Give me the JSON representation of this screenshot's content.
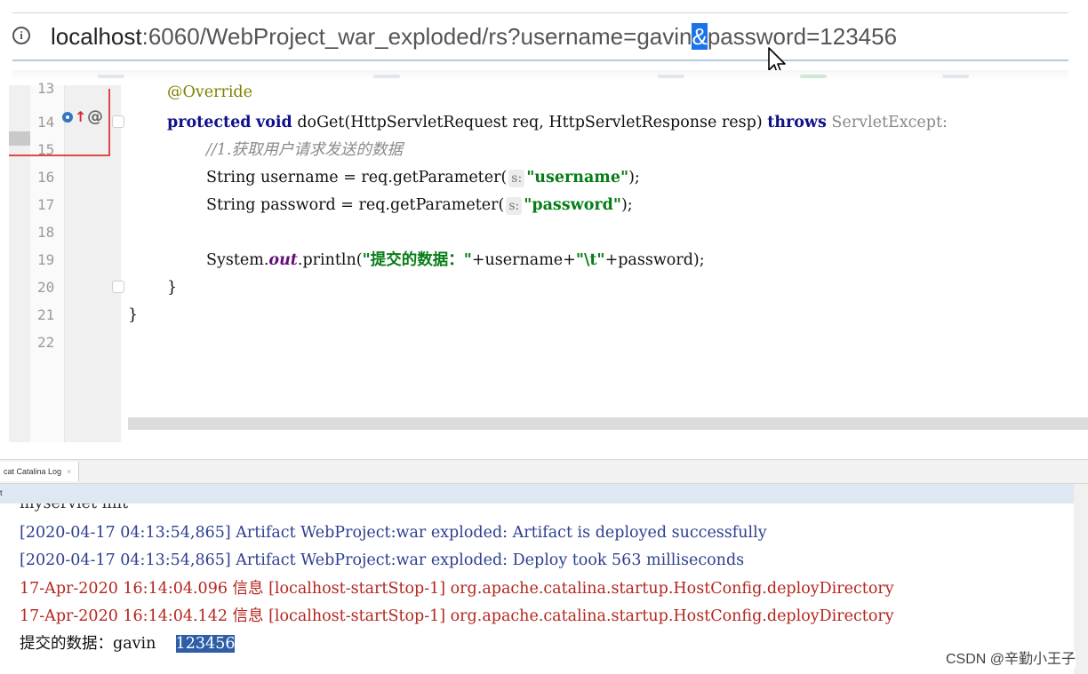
{
  "address_bar": {
    "url_host": "localhost",
    "url_rest": ":6060/WebProject_war_exploded/rs?username=gavin",
    "url_amp": "&",
    "url_tail": "password=123456"
  },
  "editor": {
    "line_numbers": [
      "13",
      "14",
      "15",
      "16",
      "17",
      "18",
      "19",
      "20",
      "21",
      "22"
    ],
    "lines": {
      "l13": {
        "annotation": "@Override"
      },
      "l14": {
        "kw1": "protected",
        "kw2": "void",
        "sig": " doGet(HttpServletRequest req, HttpServletResponse resp) ",
        "kw3": "throws",
        "exc": " ServletExcept:"
      },
      "l15": {
        "comment": "//1.获取用户请求发送的数据"
      },
      "l16": {
        "pre": "String username = req.getParameter(",
        "hint": "s:",
        "str": "\"username\"",
        "post": ");"
      },
      "l17": {
        "pre": "String password = req.getParameter(",
        "hint": "s:",
        "str": "\"password\"",
        "post": ");"
      },
      "l19": {
        "pre": "System.",
        "field": "out",
        "mid": ".println(",
        "str1": "\"提交的数据：\"",
        "mid2": "+username+",
        "str2": "\"\\t\"",
        "post": "+password);"
      },
      "l20": {
        "text": "}"
      },
      "l21": {
        "text": "}"
      }
    }
  },
  "tool_window": {
    "tab_label": "cat Catalina Log",
    "tab_close": "×",
    "header_label": "t"
  },
  "console": {
    "cut_line": "myservlet init",
    "lines": [
      {
        "text": "[2020-04-17 04:13:54,865] Artifact WebProject:war exploded: Artifact is deployed successfully"
      },
      {
        "text": "[2020-04-17 04:13:54,865] Artifact WebProject:war exploded: Deploy took 563 milliseconds"
      },
      {
        "text": "17-Apr-2020 16:14:04.096 信息 [localhost-startStop-1] org.apache.catalina.startup.HostConfig.deployDirectory"
      },
      {
        "text": "17-Apr-2020 16:14:04.142 信息 [localhost-startStop-1] org.apache.catalina.startup.HostConfig.deployDirectory"
      }
    ],
    "output_label": "提交的数据：gavin",
    "output_selected": "123456"
  },
  "watermark": "CSDN @辛勤小王子",
  "colors": {
    "selection": "#2f5ea8",
    "url_highlight": "#1a73e8",
    "keyword": "#10108a",
    "string": "#067d17",
    "log_info": "#2c3f8f",
    "log_error": "#b3261e"
  }
}
